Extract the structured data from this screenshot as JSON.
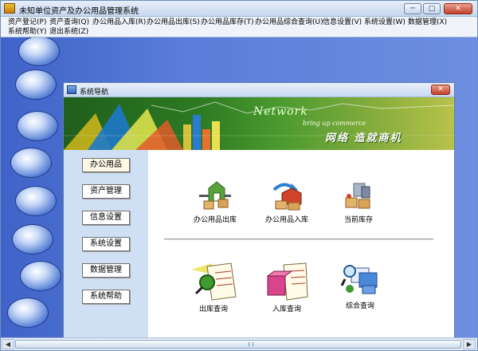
{
  "window": {
    "title": "未知单位资产及办公用品管理系统"
  },
  "menubar": {
    "items": [
      "资产登记(P)",
      "资产查询(Q)",
      "办公用品入库(R)",
      "办公用品出库(S)",
      "办公用品库存(T)",
      "办公用品综合查询(U)",
      "信息设置(V)",
      "系统设置(W)",
      "数据管理(X)",
      "系统帮助(Y)",
      "退出系统(Z)"
    ]
  },
  "child_window": {
    "title": "系统导航"
  },
  "banner": {
    "text_en": "Network",
    "text_en2": "bring up commerce",
    "text_cn": "网络 造就商机"
  },
  "nav": {
    "items": [
      "办公用品",
      "资产管理",
      "信息设置",
      "系统设置",
      "数据管理",
      "系统帮助"
    ],
    "active": "办公用品"
  },
  "tools": {
    "row1": [
      "办公用品出库",
      "办公用品入库",
      "当前库存"
    ],
    "row2": [
      "出库查询",
      "入库查询",
      "综合查询"
    ]
  },
  "icons": {
    "app": "app-icon",
    "child": "navigation-icon",
    "close": "close-icon",
    "minimize": "minimize-icon",
    "maximize": "maximize-icon"
  }
}
